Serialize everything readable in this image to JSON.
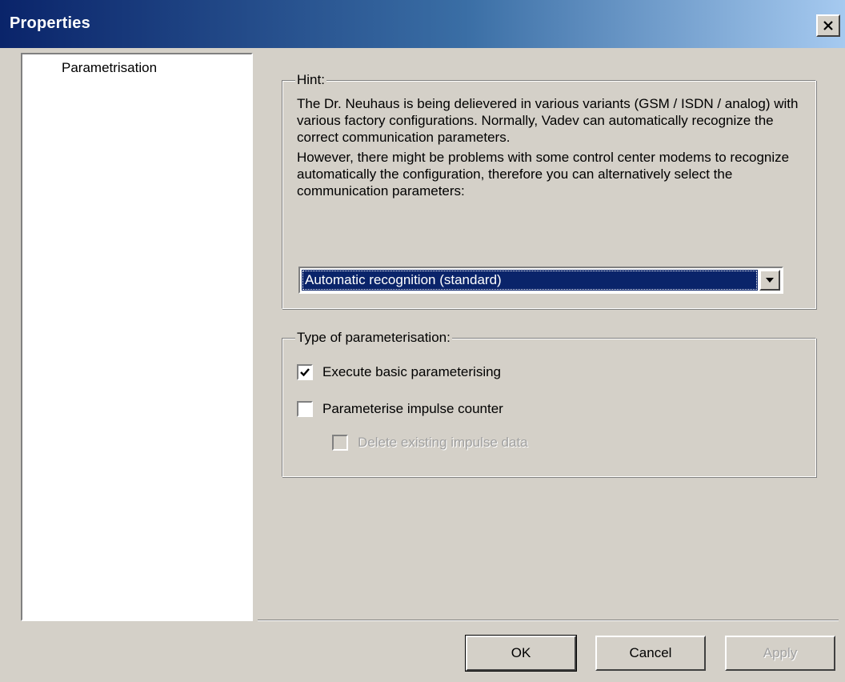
{
  "window": {
    "title": "Properties",
    "close_glyph": "✕"
  },
  "tree": {
    "items": [
      {
        "label": "Parametrisation"
      }
    ]
  },
  "hint_group": {
    "legend": "Hint:",
    "paragraph1": "The Dr. Neuhaus is being delievered in various variants (GSM / ISDN / analog) with various factory configurations. Normally, Vadev can automatically recognize the correct communication parameters.",
    "paragraph2": "However, there might be problems with some control center modems to recognize automatically the configuration, therefore you can alternatively select the communication parameters:",
    "dropdown": {
      "selected": "Automatic recognition (standard)",
      "arrow_icon": "chevron-down-icon"
    }
  },
  "type_group": {
    "legend": "Type of parameterisation:",
    "options": [
      {
        "label": "Execute basic parameterising",
        "checked": true,
        "enabled": true
      },
      {
        "label": "Parameterise impulse counter",
        "checked": false,
        "enabled": true
      },
      {
        "label": "Delete existing impulse data",
        "checked": false,
        "enabled": false
      }
    ]
  },
  "buttons": {
    "ok": "OK",
    "cancel": "Cancel",
    "apply": "Apply"
  },
  "colors": {
    "titlebar_start": "#0a246a",
    "titlebar_end": "#a6caf0",
    "face": "#d4d0c8",
    "selection": "#0a246a"
  }
}
